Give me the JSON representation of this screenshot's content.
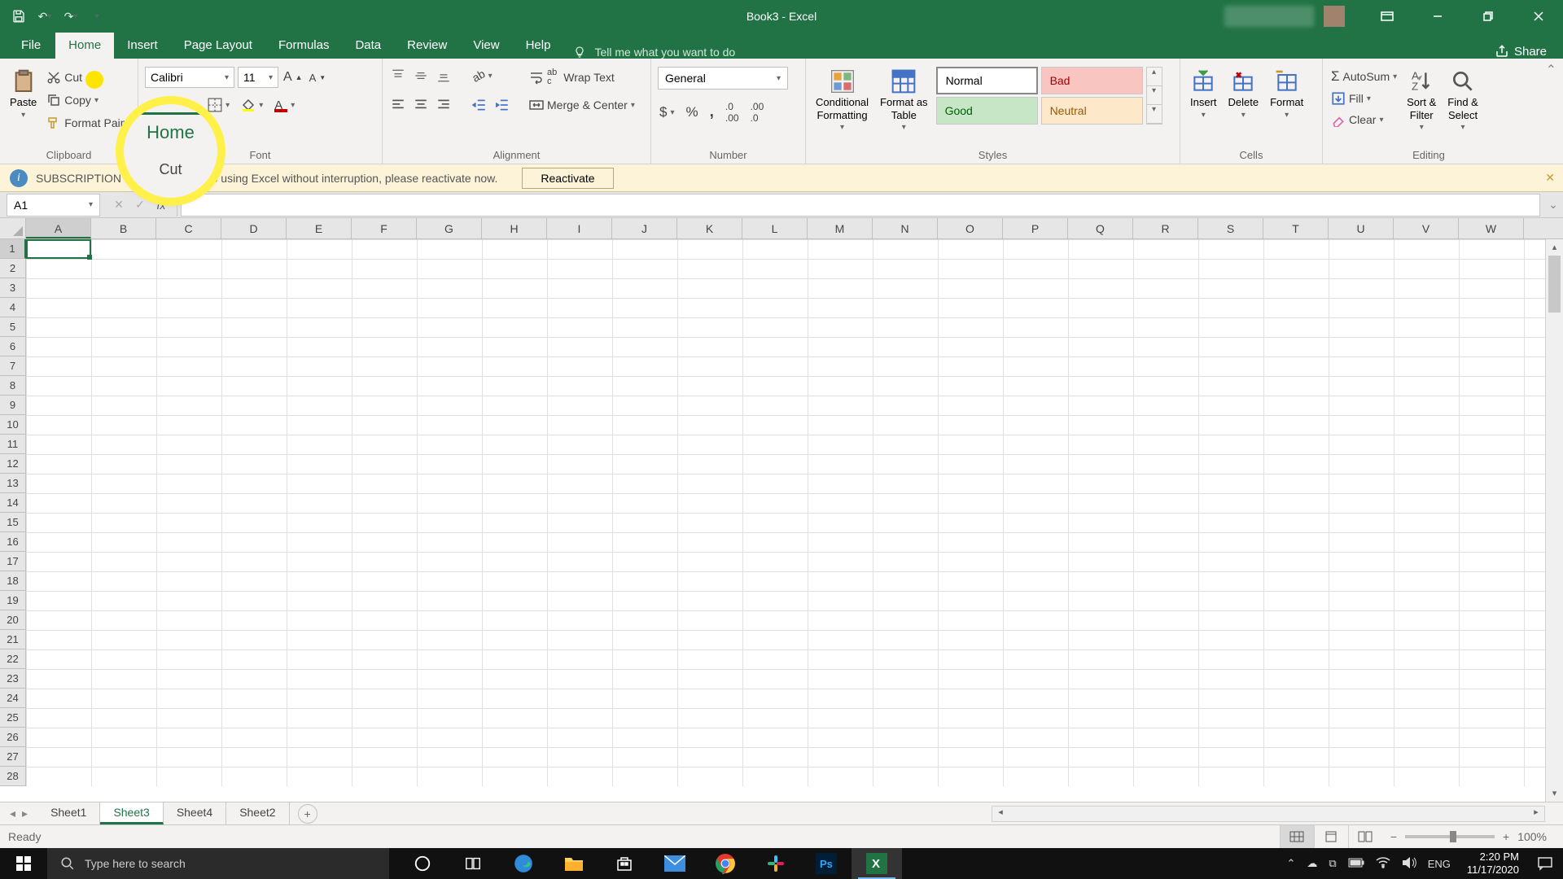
{
  "title": "Book3 - Excel",
  "qat": {
    "save": "save",
    "undo": "undo",
    "redo": "redo"
  },
  "window": {
    "min": "minimize",
    "max": "restore",
    "close": "close"
  },
  "tabs": [
    "File",
    "Home",
    "Insert",
    "Page Layout",
    "Formulas",
    "Data",
    "Review",
    "View",
    "Help"
  ],
  "active_tab": "Home",
  "tellme_placeholder": "Tell me what you want to do",
  "share_label": "Share",
  "ribbon": {
    "clipboard": {
      "label": "Clipboard",
      "paste": "Paste",
      "cut": "Cut",
      "copy": "Copy",
      "painter": "Format Painter"
    },
    "font": {
      "label": "Font",
      "name": "Calibri",
      "size": "11"
    },
    "alignment": {
      "label": "Alignment",
      "wrap": "Wrap Text",
      "merge": "Merge & Center"
    },
    "number": {
      "label": "Number",
      "format": "General"
    },
    "styles": {
      "label": "Styles",
      "cond": "Conditional\nFormatting",
      "table": "Format as\nTable",
      "normal": "Normal",
      "bad": "Bad",
      "good": "Good",
      "neutral": "Neutral"
    },
    "cells": {
      "label": "Cells",
      "insert": "Insert",
      "delete": "Delete",
      "format": "Format"
    },
    "editing": {
      "label": "Editing",
      "autosum": "AutoSum",
      "fill": "Fill",
      "clear": "Clear",
      "sort": "Sort &\nFilter",
      "find": "Find &\nSelect"
    }
  },
  "msgbar": {
    "title": "SUBSCRIPTION EXPIRED",
    "text": "To keep using Excel without interruption, please reactivate now.",
    "button": "Reactivate"
  },
  "namebox": "A1",
  "columns": [
    "A",
    "B",
    "C",
    "D",
    "E",
    "F",
    "G",
    "H",
    "I",
    "J",
    "K",
    "L",
    "M",
    "N",
    "O",
    "P",
    "Q",
    "R",
    "S",
    "T",
    "U",
    "V",
    "W"
  ],
  "rows": 28,
  "sheets": [
    "Sheet1",
    "Sheet3",
    "Sheet4",
    "Sheet2"
  ],
  "active_sheet": "Sheet3",
  "status": "Ready",
  "zoom": "100%",
  "callout": {
    "tab": "Home",
    "item": "Cut"
  },
  "taskbar": {
    "search_placeholder": "Type here to search",
    "lang": "ENG",
    "time": "2:20 PM",
    "date": "11/17/2020"
  }
}
